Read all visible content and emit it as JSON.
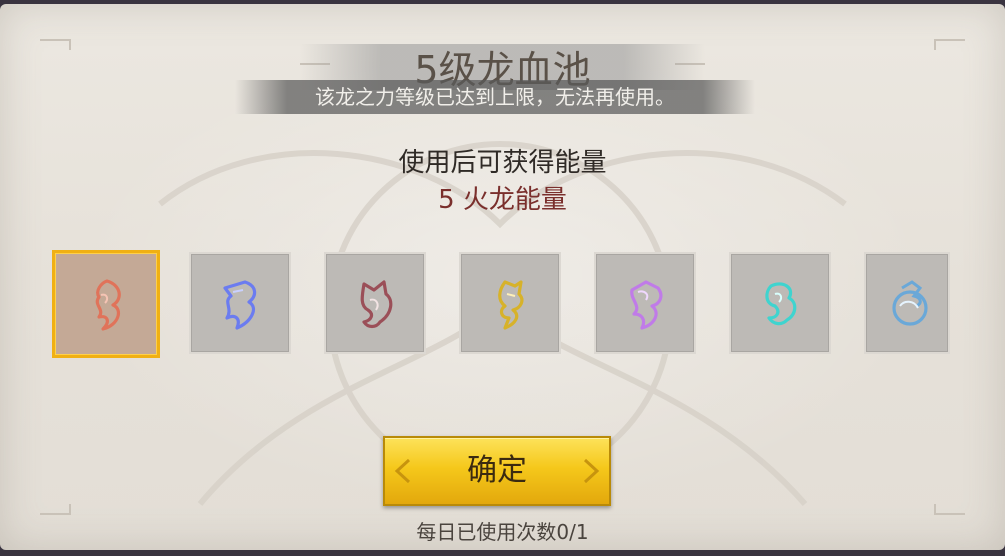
{
  "dialog": {
    "title": "5级龙血池",
    "notice": "该龙之力等级已达到上限，无法再使用。",
    "subtitle": "使用后可获得能量",
    "energy_reward": "5 火龙能量",
    "confirm_label": "确定",
    "daily_usage": "每日已使用次数0/1"
  },
  "dragons": [
    {
      "name": "fire-dragon-icon",
      "color": "#e0735a",
      "selected": true
    },
    {
      "name": "ice-dragon-icon",
      "color": "#6b7cf0",
      "selected": false
    },
    {
      "name": "dark-dragon-icon",
      "color": "#9b4f58",
      "selected": false
    },
    {
      "name": "gold-dragon-icon",
      "color": "#d7b22a",
      "selected": false
    },
    {
      "name": "purple-dragon-icon",
      "color": "#c07be8",
      "selected": false
    },
    {
      "name": "cyan-dragon-icon",
      "color": "#3fd4cf",
      "selected": false
    },
    {
      "name": "storm-dragon-icon",
      "color": "#6aa8d8",
      "selected": false
    }
  ],
  "colors": {
    "accent_gold": "#f0b014",
    "energy_text": "#7a2f2c"
  }
}
